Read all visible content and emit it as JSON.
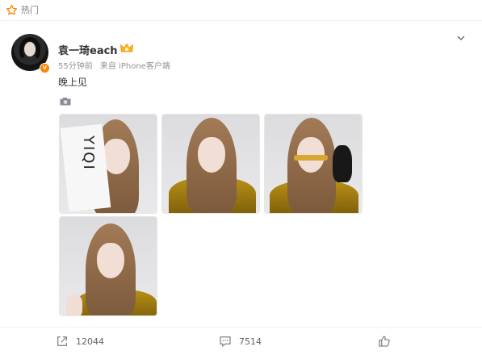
{
  "header": {
    "hot_label": "热门"
  },
  "post": {
    "author": "袁一琦each",
    "time": "55分钟前",
    "source": "来自 iPhone客户端",
    "text": "晚上见",
    "images": [
      {
        "alt": "photo-1"
      },
      {
        "alt": "photo-2"
      },
      {
        "alt": "photo-3"
      },
      {
        "alt": "photo-4"
      }
    ],
    "paper_text": "YIQI"
  },
  "actions": {
    "share_count": "12044",
    "comment_count": "7514"
  },
  "colors": {
    "accent": "#ff8200",
    "meta": "#939393",
    "text": "#333333"
  },
  "icons": [
    "star-icon",
    "crown-icon",
    "chevron-down-icon",
    "camera-icon",
    "share-icon",
    "comment-icon",
    "like-icon"
  ]
}
